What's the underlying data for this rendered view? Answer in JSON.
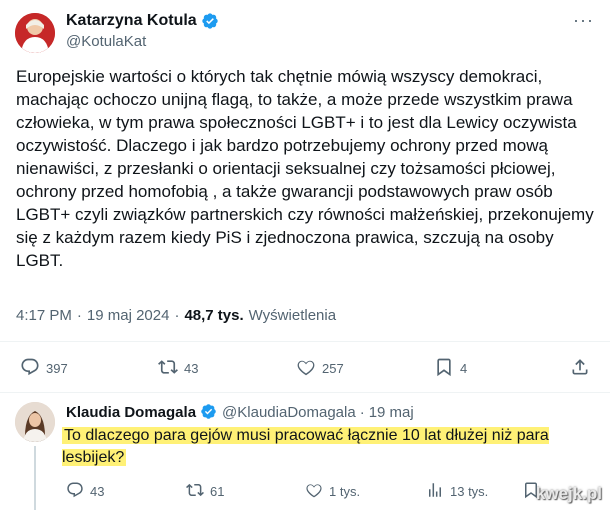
{
  "tweet": {
    "author_name": "Katarzyna Kotula",
    "author_handle": "@KotulaKat",
    "text": "Europejskie wartości o których tak chętnie mówią wszyscy demokraci, machając ochoczo unijną flagą, to także, a może przede wszystkim prawa człowieka, w tym prawa społeczności LGBT+ i to jest dla Lewicy oczywista oczywistość. Dlaczego i jak bardzo potrzebujemy ochrony przed mową nienawiści, z przesłanki o orientacji seksualnej czy tożsamości płciowej, ochrony przed homofobią , a także gwarancji podstawowych praw osób LGBT+ czyli związków partnerskich czy równości małżeńskiej, przekonujemy się z każdym razem kiedy PiS i zjednoczona prawica, szczują na osoby LGBT.",
    "time": "4:17 PM",
    "separator": "·",
    "date": "19 maj 2024",
    "views_count": "48,7 tys.",
    "views_label": "Wyświetlenia",
    "more_label": "···",
    "actions": {
      "replies": "397",
      "retweets": "43",
      "likes": "257",
      "bookmarks": "4"
    },
    "icons": {
      "reply": "reply-icon",
      "retweet": "retweet-icon",
      "like": "heart-icon",
      "bookmark": "bookmark-icon",
      "share": "share-icon",
      "verified": "verified-badge-icon"
    }
  },
  "reply": {
    "author_name": "Klaudia Domagala",
    "author_handle": "@KlaudiaDomagala",
    "separator": "·",
    "date": "19 maj",
    "text": "To dlaczego para gejów musi pracować łącznie 10 lat dłużej niż para lesbijek?",
    "actions": {
      "replies": "43",
      "retweets": "61",
      "likes": "1 tys.",
      "views": "13 tys."
    }
  },
  "watermark": "kwejk.pl",
  "colors": {
    "verified": "#1d9bf0",
    "secondary_text": "#536471",
    "highlight": "#fff176"
  }
}
